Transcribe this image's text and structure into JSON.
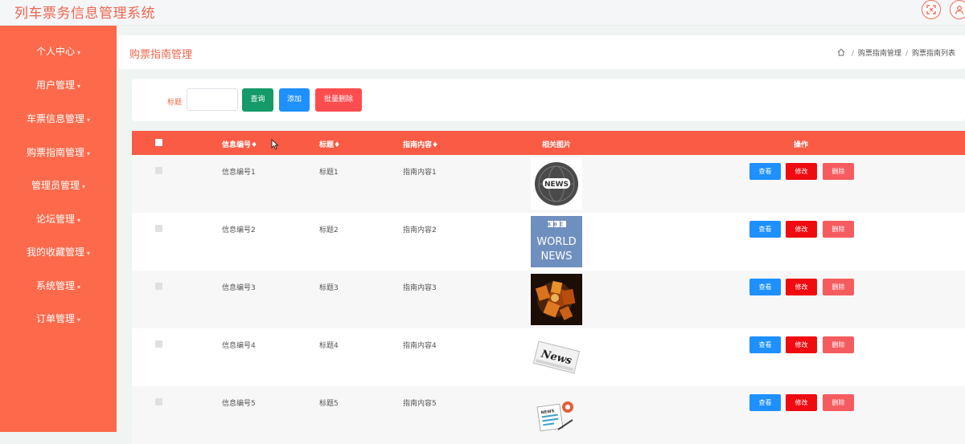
{
  "header": {
    "app_title": "列车票务信息管理系统",
    "icons": [
      "fullscreen-icon",
      "user-icon"
    ]
  },
  "sidebar": {
    "items": [
      {
        "label": "个人中心"
      },
      {
        "label": "用户管理"
      },
      {
        "label": "车票信息管理"
      },
      {
        "label": "购票指南管理"
      },
      {
        "label": "管理员管理"
      },
      {
        "label": "论坛管理"
      },
      {
        "label": "我的收藏管理"
      },
      {
        "label": "系统管理"
      },
      {
        "label": "订单管理"
      }
    ],
    "caret": "▾"
  },
  "breadcrumb": {
    "page_title": "购票指南管理",
    "items": [
      "购票指南管理",
      "购票指南列表"
    ],
    "separator": "/"
  },
  "search": {
    "label": "标题",
    "value": "",
    "query_button": "查询",
    "add_button": "添加",
    "batch_delete_button": "批量删除"
  },
  "table": {
    "columns": [
      "信息编号",
      "标题",
      "指南内容",
      "相关图片",
      "操作"
    ],
    "sort_mark": "♦",
    "rows": [
      {
        "id": "信息编号1",
        "title": "标题1",
        "content": "指南内容1",
        "image": "news-globe"
      },
      {
        "id": "信息编号2",
        "title": "标题2",
        "content": "指南内容2",
        "image": "bbc-world-news"
      },
      {
        "id": "信息编号3",
        "title": "标题3",
        "content": "指南内容3",
        "image": "news-letters-dark"
      },
      {
        "id": "信息编号4",
        "title": "标题4",
        "content": "指南内容4",
        "image": "newspaper"
      },
      {
        "id": "信息编号5",
        "title": "标题5",
        "content": "指南内容5",
        "image": "news-illustration"
      }
    ],
    "actions": {
      "view": "查看",
      "edit": "修改",
      "delete": "删除"
    },
    "thumb_text": {
      "news_badge": "NEWS",
      "bbc_line1": "BBC",
      "bbc_line2": "WORLD",
      "bbc_line3": "NEWS",
      "newspaper": "News",
      "illustration": "NEWS"
    }
  },
  "colors": {
    "accent": "#fc6a4b",
    "header_row": "#f95b45",
    "query": "#159a6a",
    "add": "#1e90ff",
    "batch_delete": "#ff4d4f",
    "view": "#1e90ff",
    "edit": "#ef0b10",
    "delete": "#f65c5f"
  }
}
